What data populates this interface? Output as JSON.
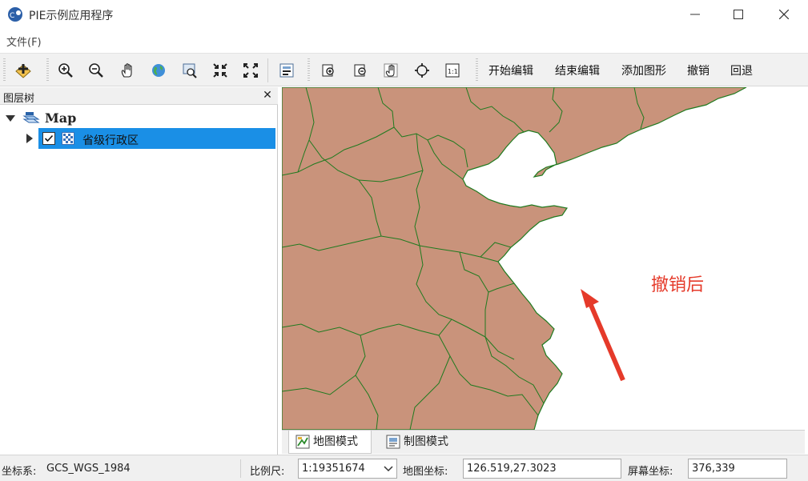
{
  "window": {
    "title": "PIE示例应用程序",
    "minimize_glyph": "—",
    "maximize_glyph": "☐",
    "close_glyph": "✕"
  },
  "menu": {
    "items": [
      {
        "label": "文件(F)"
      }
    ]
  },
  "toolbar": {
    "icons": [
      "add-data-icon",
      "zoom-in-icon",
      "zoom-out-icon",
      "pan-hand-icon",
      "globe-full-extent-icon",
      "identify-icon",
      "zoom-fixed-in-icon",
      "zoom-fixed-out-icon",
      "layout-icon",
      "previous-extent-icon",
      "next-extent-icon",
      "layout-pan-icon",
      "layout-full-icon",
      "layout-one-to-one-icon"
    ],
    "text_buttons": [
      {
        "label": "开始编辑"
      },
      {
        "label": "结束编辑"
      },
      {
        "label": "添加图形"
      },
      {
        "label": "撤销"
      },
      {
        "label": "回退"
      }
    ]
  },
  "layer_panel": {
    "title": "图层树",
    "close_glyph": "✕",
    "root_label": "Map",
    "layers": [
      {
        "label": "省级行政区",
        "checked": true,
        "selected": true
      }
    ]
  },
  "map": {
    "annotation": "撤销后",
    "land_color": "#c9937b",
    "boundary_color": "#1f7a1f",
    "annotation_color": "#e53a2a"
  },
  "tabs": [
    {
      "label": "地图模式",
      "active": true
    },
    {
      "label": "制图模式",
      "active": false
    }
  ],
  "status": {
    "crs_label": "坐标系:",
    "crs_value": "GCS_WGS_1984",
    "scale_label": "比例尺:",
    "scale_value": "1:19351674",
    "map_coord_label": "地图坐标:",
    "map_coord_value": "126.519,27.3023",
    "screen_coord_label": "屏幕坐标:",
    "screen_coord_value": "376,339"
  },
  "colors": {
    "selection": "#1a8fe6",
    "toolbar_bg": "#f1f1f1"
  }
}
